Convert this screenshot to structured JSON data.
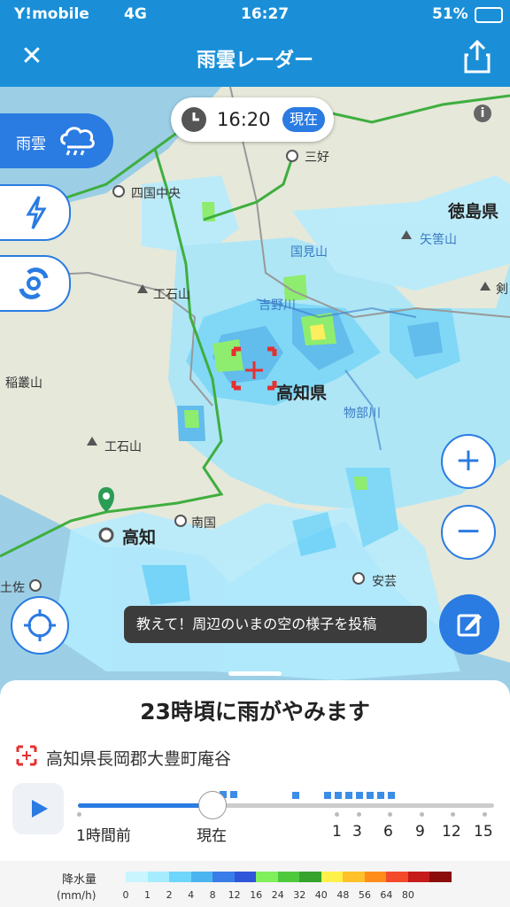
{
  "status": {
    "carrier": "Y!mobile",
    "network": "4G",
    "time": "16:27",
    "battery": "51%"
  },
  "header": {
    "title": "雨雲レーダー",
    "close_icon": "close-icon",
    "share_icon": "share-icon"
  },
  "map": {
    "time": "16:20",
    "now_badge": "現在",
    "labels": {
      "shikoku_chuo": "四国中央",
      "miyoshi": "三好",
      "tokushima": "徳島県",
      "ishizuchi": "工石山",
      "kunimi": "国見山",
      "yoshino": "吉野川",
      "yazume": "矢筈山",
      "inamura": "稲叢山",
      "kochi_pref": "高知県",
      "monobe": "物部川",
      "ishizuchi2": "工石山",
      "nankoku": "南国",
      "kochi": "高知",
      "tosa": "土佐",
      "aki": "安芸",
      "tsurugi": "剣"
    },
    "rain_button": "雨雲",
    "post_tip": "教えて！周辺のいまの空の様子を投稿"
  },
  "panel": {
    "message": "23時頃に雨がやみます",
    "location": "高知県長岡郡大豊町庵谷",
    "timeline_labels": [
      "1時間前",
      "現在",
      "1",
      "3",
      "6",
      "9",
      "12",
      "15"
    ]
  },
  "legend": {
    "title": "降水量",
    "unit": "(mm/h)",
    "values": [
      "0",
      "1",
      "2",
      "4",
      "8",
      "12",
      "16",
      "24",
      "32",
      "40",
      "48",
      "56",
      "64",
      "80"
    ],
    "colors": [
      "#c9f5ff",
      "#a5ecff",
      "#6fd6fb",
      "#4cb5f0",
      "#3b7de8",
      "#2f55d8",
      "#7fef5c",
      "#4fc93c",
      "#35a32c",
      "#fff04a",
      "#ffc12a",
      "#ff8d1c",
      "#f24a2a",
      "#c51b1b",
      "#8c0c0c"
    ]
  }
}
